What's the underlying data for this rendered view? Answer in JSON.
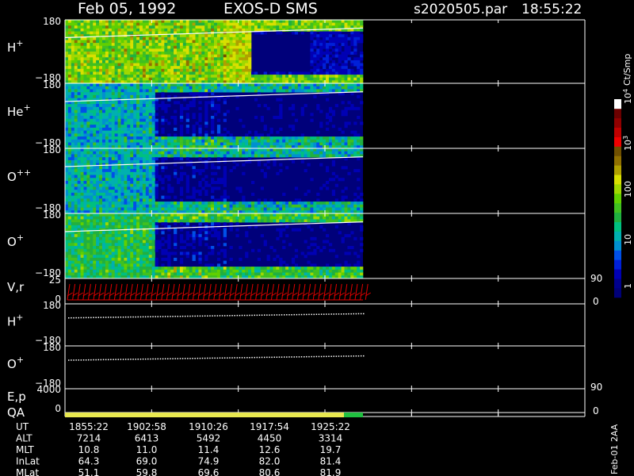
{
  "header": {
    "date": "Feb 05, 1992",
    "instrument": "EXOS-D SMS",
    "file": "s2020505.par",
    "time": "18:55:22"
  },
  "colorbar": {
    "unit_label": "Ct/Smp",
    "tick_labels": [
      "1",
      "10",
      "100",
      "10",
      "10"
    ],
    "tick_exponents": [
      "",
      "",
      "",
      "3",
      "4"
    ],
    "colors": [
      "#000078",
      "#00008c",
      "#0000b4",
      "#0020d8",
      "#0050e8",
      "#0090d0",
      "#00b0b0",
      "#00c080",
      "#20b040",
      "#40c020",
      "#60d000",
      "#a0d800",
      "#d8e000",
      "#b0a000",
      "#907000",
      "#705000",
      "#f00000",
      "#c00000",
      "#900000",
      "#6a0000",
      "#ffffff"
    ]
  },
  "chart_data": [
    {
      "type": "heatmap",
      "panels": [
        {
          "name": "H",
          "superscript": "+",
          "ylim": [
            -180,
            180
          ],
          "ytick_labels": [
            "180",
            "−180"
          ],
          "intensity": "high"
        },
        {
          "name": "He",
          "superscript": "+",
          "ylim": [
            -180,
            180
          ],
          "ytick_labels": [
            "180",
            "−180"
          ],
          "intensity": "low"
        },
        {
          "name": "O",
          "superscript": "++",
          "ylim": [
            -180,
            180
          ],
          "ytick_labels": [
            "180",
            "−180"
          ],
          "intensity": "low"
        },
        {
          "name": "O",
          "superscript": "+",
          "ylim": [
            -180,
            180
          ],
          "ytick_labels": [
            "180",
            "−180"
          ],
          "intensity": "medium"
        }
      ]
    },
    {
      "type": "line",
      "panels": [
        {
          "name": "V,r",
          "ytick_labels": [
            "25",
            "0"
          ],
          "right_tick_labels": [
            "90",
            "0"
          ]
        },
        {
          "name": "H",
          "superscript": "+",
          "ytick_labels": [
            "180",
            "−180"
          ]
        },
        {
          "name": "O",
          "superscript": "+",
          "ytick_labels": [
            "180",
            "−180"
          ]
        },
        {
          "name": "E,p",
          "ytick_labels": [
            "4000"
          ],
          "right_tick_labels": [
            "90"
          ]
        },
        {
          "name": "QA",
          "ytick_labels": [
            "0"
          ],
          "right_tick_labels": [
            "0"
          ]
        }
      ]
    }
  ],
  "footer": {
    "rows": [
      {
        "label": "UT",
        "values": [
          "1855:22",
          "1902:58",
          "1910:26",
          "1917:54",
          "1925:22"
        ]
      },
      {
        "label": "ALT",
        "values": [
          "7214",
          "6413",
          "5492",
          "4450",
          "3314"
        ]
      },
      {
        "label": "MLT",
        "values": [
          "10.8",
          "11.0",
          "11.4",
          "12.6",
          "19.7"
        ]
      },
      {
        "label": "InLat",
        "values": [
          "64.3",
          "69.0",
          "74.9",
          "82.0",
          "81.4"
        ]
      },
      {
        "label": "MLat",
        "values": [
          "51.1",
          "59.8",
          "69.6",
          "80.6",
          "81.9"
        ]
      }
    ],
    "side_label": "Feb-01 2AA"
  }
}
